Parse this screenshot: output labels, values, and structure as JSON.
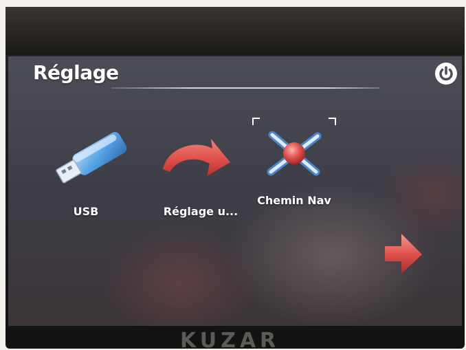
{
  "screen": {
    "title": "Réglage",
    "power_icon": "power-icon",
    "tiles": [
      {
        "label": "USB",
        "icon": "usb-drive-icon"
      },
      {
        "label": "Réglage u...",
        "icon": "curved-arrow-icon"
      },
      {
        "label": "Chemin Nav",
        "icon": "nav-path-icon",
        "selected": true
      }
    ],
    "next_icon": "next-arrow-icon"
  },
  "device": {
    "brand": "KUZAR"
  },
  "colors": {
    "accent_red": "#e0524e",
    "usb_blue": "#5aa6e6",
    "text": "#ffffff"
  }
}
